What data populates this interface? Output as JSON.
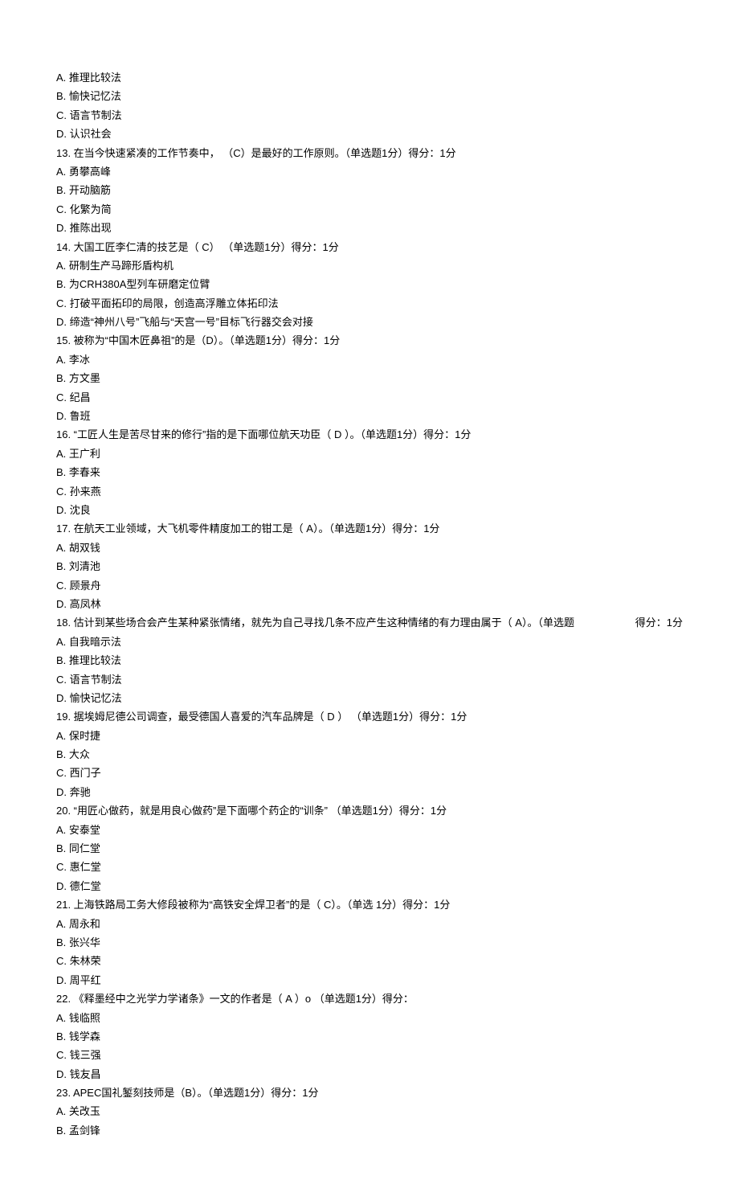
{
  "q12": {
    "A": "A.  推理比较法",
    "B": "B.  愉快记忆法",
    "C": "C.  语言节制法",
    "D": "D.  认识社会"
  },
  "q13": {
    "stem": "13.  在当今快速紧凑的工作节奏中，    （C）是最好的工作原则。（单选题1分）得分：1分",
    "A": "A.  勇攀高峰",
    "B": "B.  开动脑筋",
    "C": "C.  化繁为简",
    "D": "D.  推陈出现"
  },
  "q14": {
    "stem": "14.  大国工匠李仁清的技艺是（ C） （单选题1分）得分：1分",
    "A": "A.  研制生产马蹄形盾构机",
    "B": "B.  为CRH380A型列车研磨定位臂",
    "C": "C.  打破平面拓印的局限，创造高浮雕立体拓印法",
    "D": "D.  缔造“神州八号”飞船与“天宫一号”目标飞行器交会对接"
  },
  "q15": {
    "stem": "15.  被称为“中国木匠鼻祖”的是（D）。（单选题1分）得分：1分",
    "A": "A.  李冰",
    "B": "B.  方文墨",
    "C": "C.  纪昌",
    "D": "D.  鲁班"
  },
  "q16": {
    "stem": "16.  “工匠人生是苦尽甘来的修行”指的是下面哪位航天功臣（        D ）。（单选题1分）得分：1分",
    "A": "A.  王广利",
    "B": "B.  李春来",
    "C": "C.  孙来燕",
    "D": "D.  沈良"
  },
  "q17": {
    "stem": "17.  在航天工业领域，大飞机零件精度加工的钳工是（     A）。（单选题1分）得分：1分",
    "A": "A.  胡双钱",
    "B": "B.  刘清池",
    "C": "C.  顾景舟",
    "D": "D.  高凤林"
  },
  "q18": {
    "stem": "18.  估计到某些场合会产生某种紧张情绪，就先为自己寻找几条不应产生这种情绪的有力理由属于（            A）。（单选题",
    "trailing": "得分：1分",
    "A": "A.  自我暗示法",
    "B": "B.  推理比较法",
    "C": "C.  语言节制法",
    "D": "D.  愉快记忆法"
  },
  "q19": {
    "stem": "19.  据埃姆尼德公司调查，最受德国人喜爱的汽车品牌是（       D ） （单选题1分）得分：1分",
    "A": "A.  保时捷",
    "B": "B.  大众",
    "C": "C.  西门子",
    "D": "D.  奔驰"
  },
  "q20": {
    "stem": "20.  “用匠心做药，就是用良心做药”是下面哪个药企的“训条”                     （单选题1分）得分：1分",
    "A": "A.  安泰堂",
    "B": "B.  同仁堂",
    "C": "C.  惠仁堂",
    "D": "D.  德仁堂"
  },
  "q21": {
    "stem": "21.  上海铁路局工务大修段被称为“高铁安全焊卫者”的是（      C）。（单选  1分）得分：1分",
    "A": "A.  周永和",
    "B": "B.  张兴华",
    "C": "C.  朱林荣",
    "D": "D.  周平红"
  },
  "q22": {
    "stem": "22.  《释墨经中之光学力学诸条》一文的作者是（    A ）o （单选题1分）得分：",
    "A": "A.  钱临照",
    "B": "B.  钱学森",
    "C": "C.  钱三强",
    "D": "D.  钱友昌"
  },
  "q23": {
    "stem": "23.  APEC国礼錾刻技师是（B）。（单选题1分）得分：1分",
    "A": "A.  关改玉",
    "B": "B.  孟剑锋"
  }
}
